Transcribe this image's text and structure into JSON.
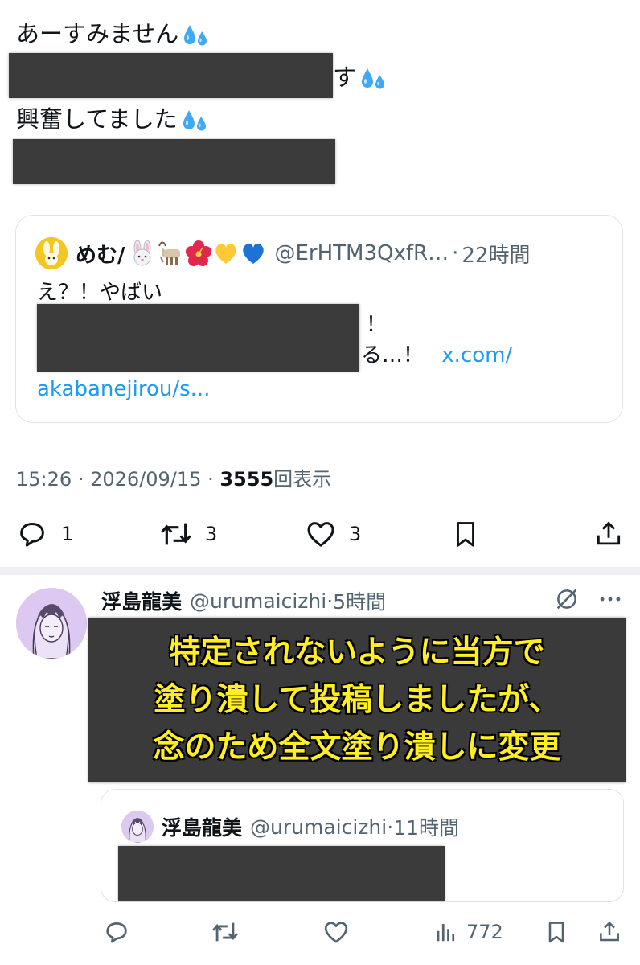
{
  "post": {
    "line1": "あーすみません",
    "line2_suffix": "す",
    "line3": "興奮してました",
    "emoji": "sweat-droplets"
  },
  "quote": {
    "name": "めむ/",
    "emojis": [
      "rabbit-face",
      "goat",
      "hibiscus",
      "yellow-heart",
      "blue-heart"
    ],
    "handle": "@ErHTM3QxfR…",
    "dot": "·",
    "time": "22時間",
    "line1": "え？！やばい",
    "line2_suffix": "！",
    "line3_suffix": "る…！",
    "link1": "x.com/",
    "link2": "akabanejirou/s..."
  },
  "meta": {
    "time": "15:26",
    "sep1": "·",
    "date": "2026/09/15",
    "sep2": "·",
    "views": "3555",
    "views_label": "回表示"
  },
  "actions": {
    "reply_count": "1",
    "retweet_count": "3",
    "like_count": "3"
  },
  "reply": {
    "name": "浮島龍美",
    "handle": "@urumaicizhi",
    "dot": "·",
    "time": "5時間",
    "overlay": {
      "line1": "特定されないように当方で",
      "line2": "塗り潰して投稿しましたが、",
      "line3": "念のため全文塗り潰しに変更"
    },
    "quote": {
      "name": "浮島龍美",
      "handle": "@urumaicizhi",
      "dot": "·",
      "time": "11時間"
    },
    "views": "772"
  },
  "colors": {
    "text": "#0f1419",
    "secondary": "#536471",
    "link": "#1d9bf0",
    "redaction": "#3b3b3b",
    "overlay_text": "#ffee22"
  }
}
